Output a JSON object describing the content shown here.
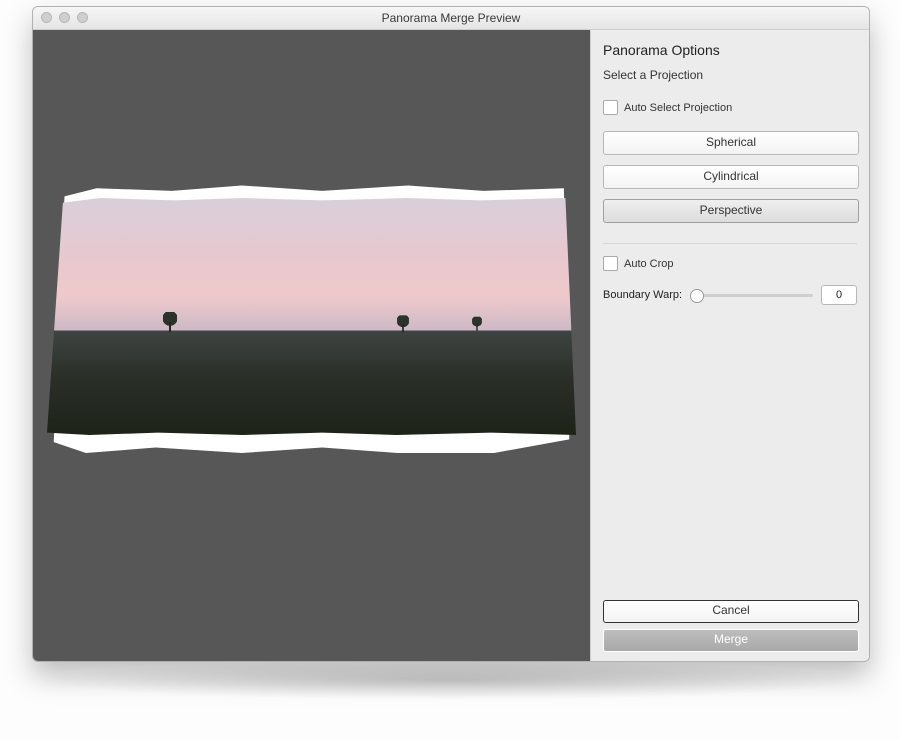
{
  "window": {
    "title": "Panorama Merge Preview"
  },
  "sidebar": {
    "heading": "Panorama Options",
    "subheading": "Select a Projection",
    "auto_select_label": "Auto Select Projection",
    "auto_select_checked": false,
    "projections": {
      "spherical": {
        "label": "Spherical",
        "selected": false
      },
      "cylindrical": {
        "label": "Cylindrical",
        "selected": false
      },
      "perspective": {
        "label": "Perspective",
        "selected": true
      }
    },
    "auto_crop_label": "Auto Crop",
    "auto_crop_checked": false,
    "boundary_warp": {
      "label": "Boundary Warp:",
      "value": "0"
    }
  },
  "footer": {
    "cancel_label": "Cancel",
    "merge_label": "Merge"
  }
}
